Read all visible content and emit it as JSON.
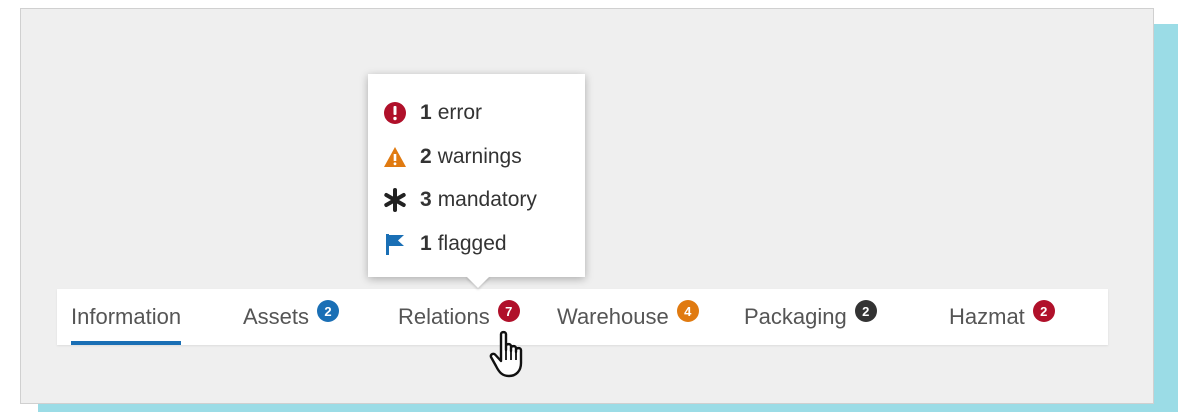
{
  "tabs": [
    {
      "label": "Information",
      "badge": null,
      "active": true
    },
    {
      "label": "Assets",
      "badge": "2",
      "badge_color": "#1a6fb5"
    },
    {
      "label": "Relations",
      "badge": "7",
      "badge_color": "#b0102a"
    },
    {
      "label": "Warehouse",
      "badge": "4",
      "badge_color": "#e07a10"
    },
    {
      "label": "Packaging",
      "badge": "2",
      "badge_color": "#333333"
    },
    {
      "label": "Hazmat",
      "badge": "2",
      "badge_color": "#b0102a"
    }
  ],
  "tooltip": {
    "rows": [
      {
        "count": "1",
        "text": "error",
        "icon": "error-icon",
        "color": "#b0102a"
      },
      {
        "count": "2",
        "text": "warnings",
        "icon": "warning-icon",
        "color": "#e07a10"
      },
      {
        "count": "3",
        "text": "mandatory",
        "icon": "asterisk-icon",
        "color": "#222222"
      },
      {
        "count": "1",
        "text": "flagged",
        "icon": "flag-icon",
        "color": "#1a6fb5"
      }
    ]
  },
  "colors": {
    "active_tab_underline": "#1a6fb5",
    "card_shadow": "#9bdce6"
  }
}
